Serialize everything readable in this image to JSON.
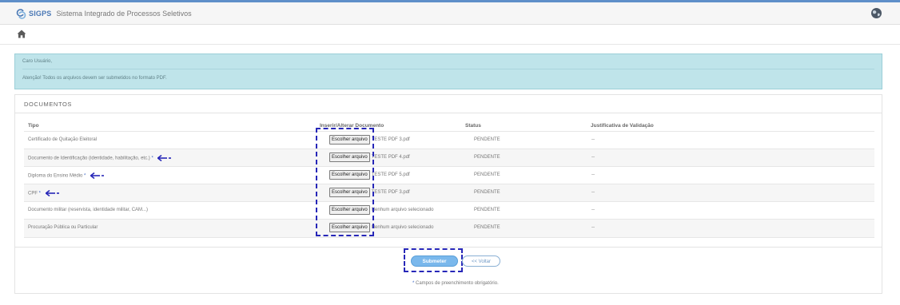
{
  "header": {
    "brand": "SIGPS",
    "system_name": "Sistema Integrado de Processos Seletivos",
    "brand_color": "#4a78b5"
  },
  "alert": {
    "line1": "Caro Usuário,",
    "line2": "Atenção! Todos os arquivos devem ser submetidos no formato PDF."
  },
  "documents": {
    "title": "DOCUMENTOS",
    "columns": {
      "tipo": "Tipo",
      "file": "Inserir/Alterar Documento",
      "status": "Status",
      "justificativa": "Justificativa de Validação"
    },
    "file_button_label": "Escolher arquivo",
    "rows": [
      {
        "tipo": "Certificado de Quitação Eleitoral",
        "required": "",
        "file": "TESTE PDF 3.pdf",
        "status": "PENDENTE",
        "justificativa": "--"
      },
      {
        "tipo": "Documento de Identificação (identidade, habilitação, etc.)",
        "required": "*",
        "file": "TESTE PDF 4.pdf",
        "status": "PENDENTE",
        "justificativa": "--"
      },
      {
        "tipo": "Diploma do Ensino Médio",
        "required": "*",
        "file": "TESTE PDF 5.pdf",
        "status": "PENDENTE",
        "justificativa": "--"
      },
      {
        "tipo": "CPF",
        "required": "*",
        "file": "TESTE PDF 3.pdf",
        "status": "PENDENTE",
        "justificativa": "--"
      },
      {
        "tipo": "Documento militar (reservista, identidade militar, CAM...)",
        "required": "",
        "file": "Nenhum arquivo selecionado",
        "status": "PENDENTE",
        "justificativa": "--"
      },
      {
        "tipo": "Procuração Pública ou Particular",
        "required": "",
        "file": "Nenhum arquivo selecionado",
        "status": "PENDENTE",
        "justificativa": "--"
      }
    ]
  },
  "actions": {
    "submit": "Submeter",
    "back": "<< Voltar"
  },
  "footer_note": {
    "asterisk": "*",
    "text": " Campos de preenchimento obrigatório."
  },
  "colors": {
    "accent": "#4a78b5",
    "alert_bg": "#bfe4ea",
    "annotation": "#2727b8",
    "submit_bg": "#7ab8ec"
  },
  "icons": {
    "logo": "sigps-logo-icon",
    "globe": "globe-icon",
    "home": "home-icon",
    "arrow": "arrow-left-icon"
  }
}
